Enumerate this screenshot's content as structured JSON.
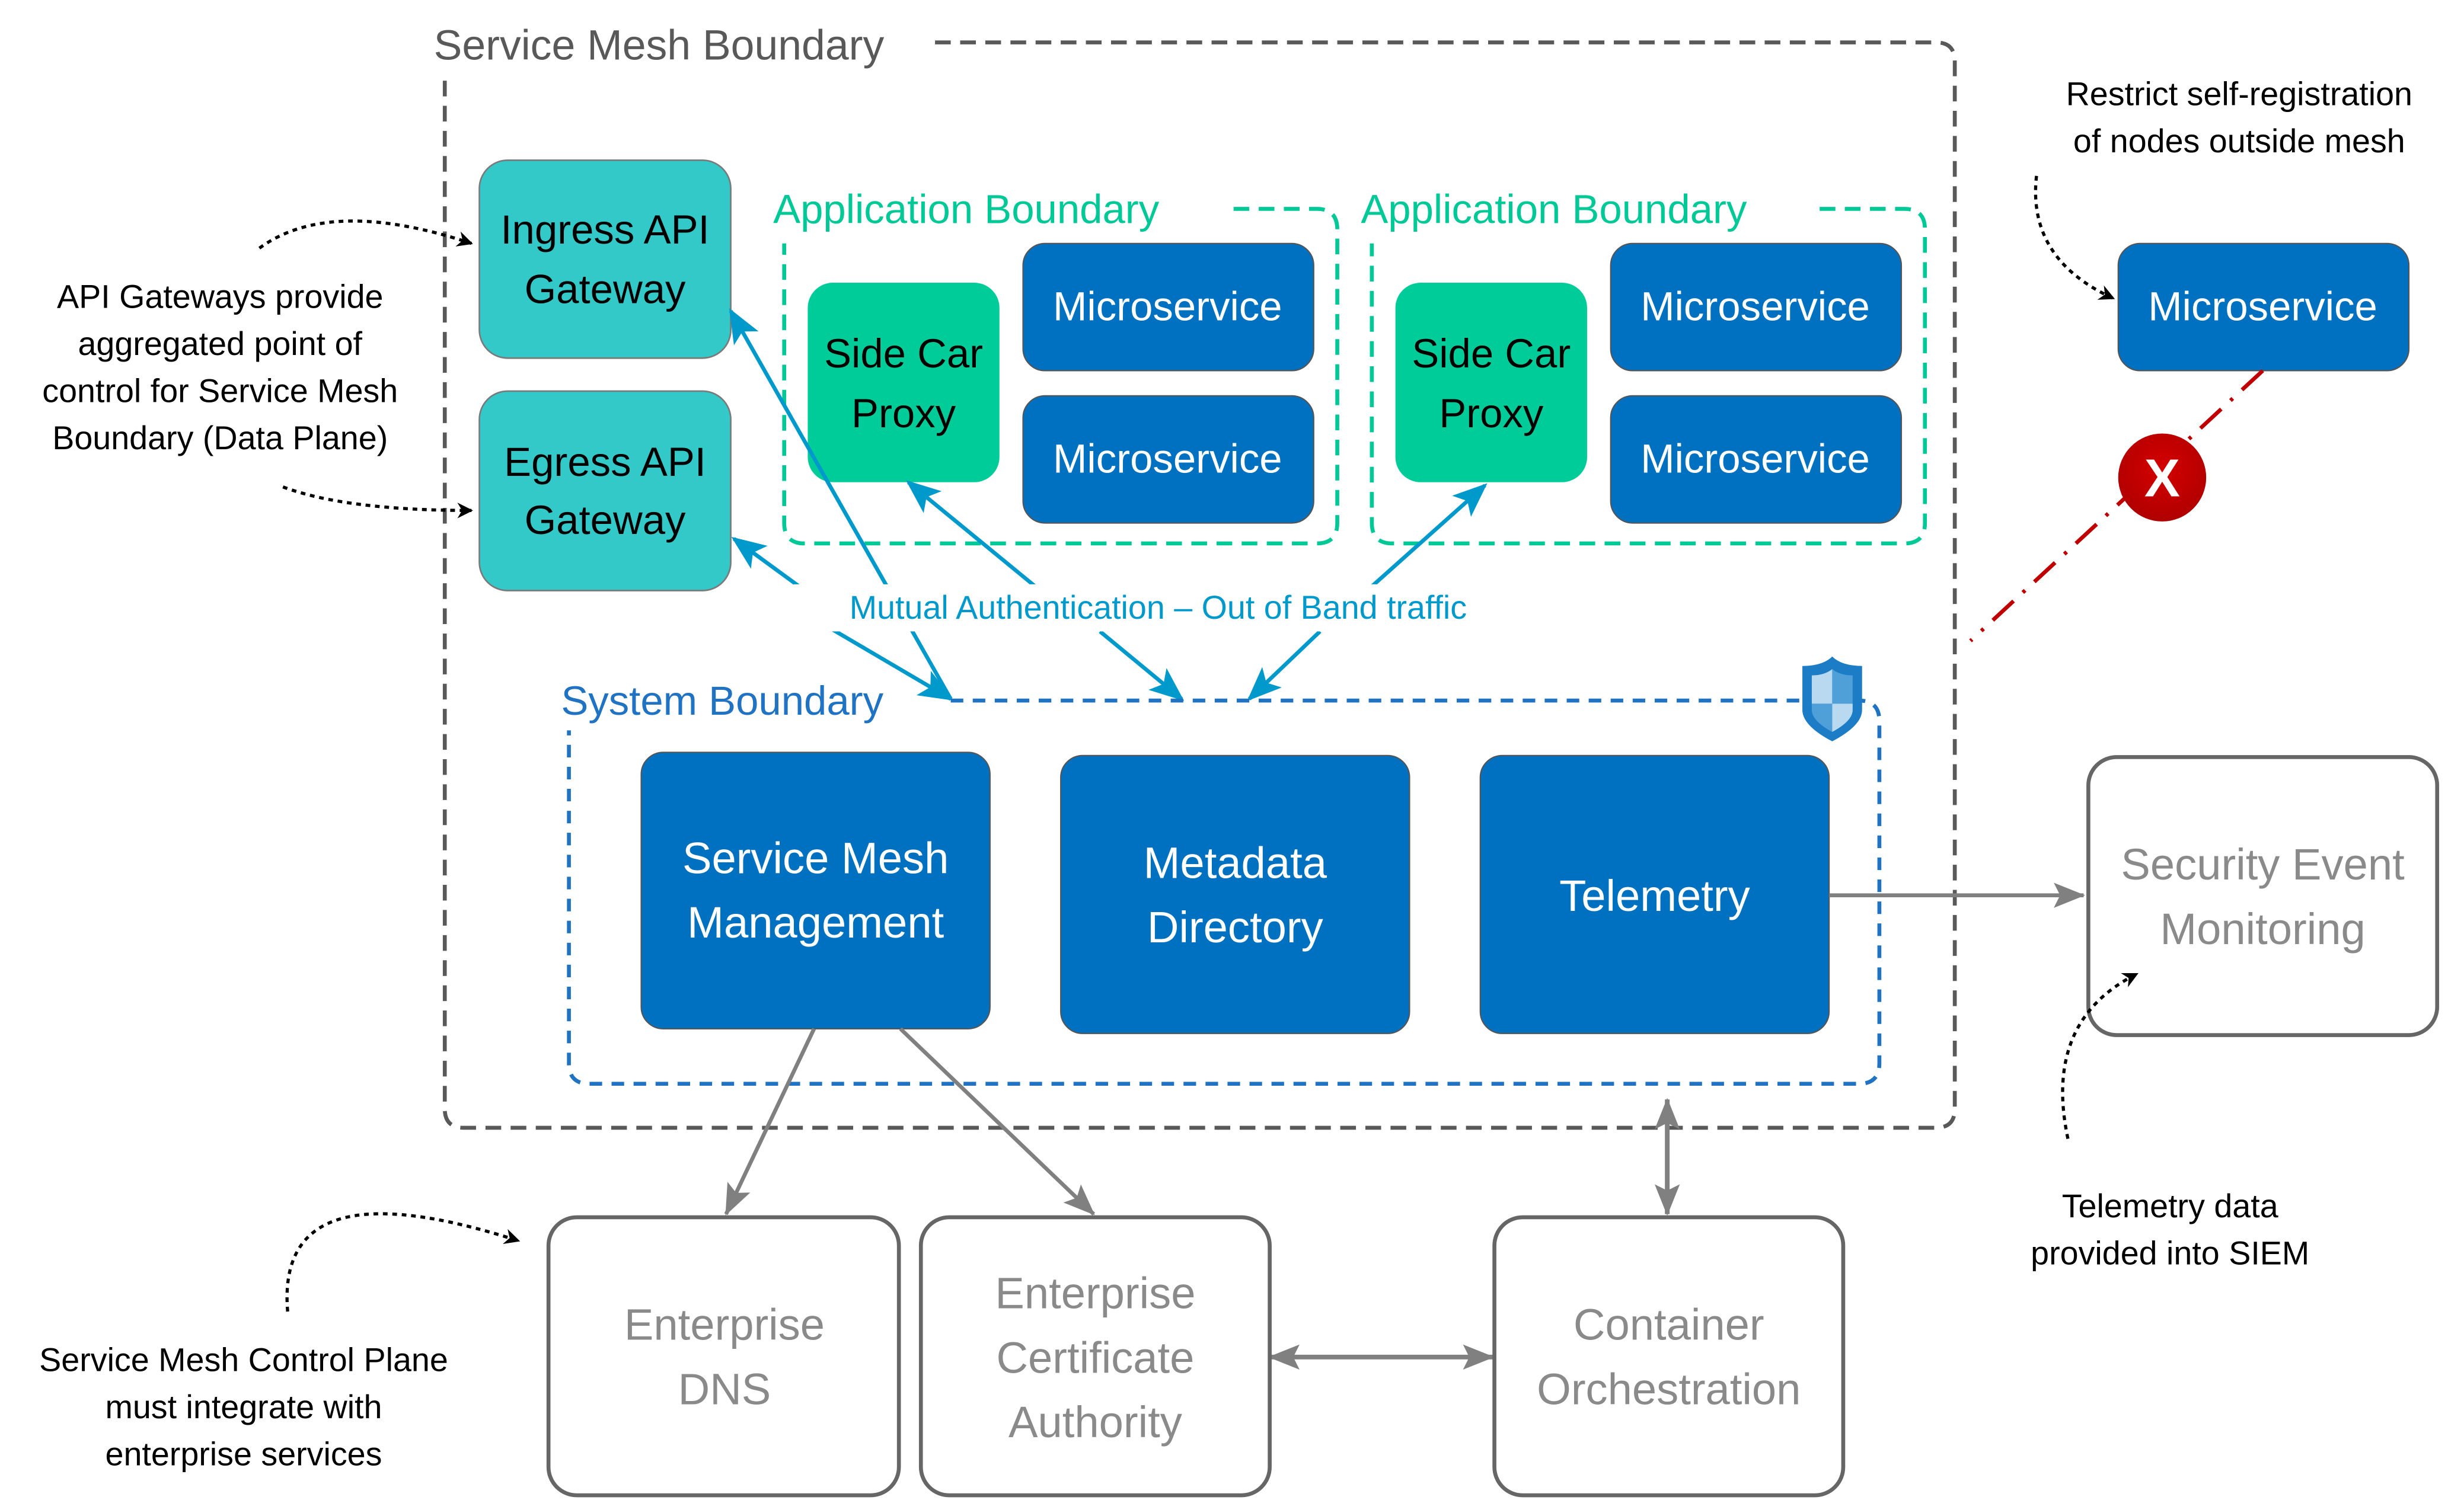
{
  "colors": {
    "gateway_fill": "#33c9c9",
    "sidecar_fill": "#00cc99",
    "microservice_fill": "#0070c0",
    "system_component_fill": "#0070c0",
    "app_boundary": "#00c896",
    "system_boundary": "#1f73c2",
    "mesh_boundary": "#595959",
    "mutual_auth": "#0099cc",
    "external_border": "#666666",
    "external_text": "#8a8a8a",
    "connector_grey": "#808080",
    "block_red": "#c00000"
  },
  "mesh_boundary": {
    "label": "Service Mesh Boundary"
  },
  "gateways": {
    "ingress": {
      "line1": "Ingress API",
      "line2": "Gateway"
    },
    "egress": {
      "line1": "Egress API",
      "line2": "Gateway"
    }
  },
  "app_boundaries": [
    {
      "label": "Application Boundary",
      "sidecar": {
        "line1": "Side Car",
        "line2": "Proxy"
      },
      "microservices": [
        "Microservice",
        "Microservice"
      ]
    },
    {
      "label": "Application Boundary",
      "sidecar": {
        "line1": "Side Car",
        "line2": "Proxy"
      },
      "microservices": [
        "Microservice",
        "Microservice"
      ]
    }
  ],
  "mutual_auth_label": "Mutual Authentication – Out of Band traffic",
  "system_boundary": {
    "label": "System Boundary",
    "icon": "shield-icon",
    "components": [
      {
        "line1": "Service Mesh",
        "line2": "Management"
      },
      {
        "line1": "Metadata",
        "line2": "Directory"
      },
      {
        "line1": "Telemetry",
        "line2": ""
      }
    ]
  },
  "external": {
    "siem": {
      "line1": "Security Event",
      "line2": "Monitoring"
    },
    "dns": {
      "line1": "Enterprise",
      "line2": "DNS"
    },
    "ca": {
      "line1": "Enterprise",
      "line2": "Certificate",
      "line3": "Authority"
    },
    "orchestration": {
      "line1": "Container",
      "line2": "Orchestration"
    }
  },
  "rogue_microservice": {
    "label": "Microservice",
    "blocked_icon": "x-circle-icon",
    "blocked_glyph": "X"
  },
  "annotations": {
    "gateways": [
      "API Gateways provide",
      "aggregated point of",
      "control for Service Mesh",
      "Boundary (Data Plane)"
    ],
    "restrict": [
      "Restrict self-registration",
      "of nodes outside mesh"
    ],
    "telemetry": [
      "Telemetry data",
      "provided into SIEM"
    ],
    "control_plane": [
      "Service Mesh Control Plane",
      "must integrate with",
      "enterprise services"
    ]
  }
}
